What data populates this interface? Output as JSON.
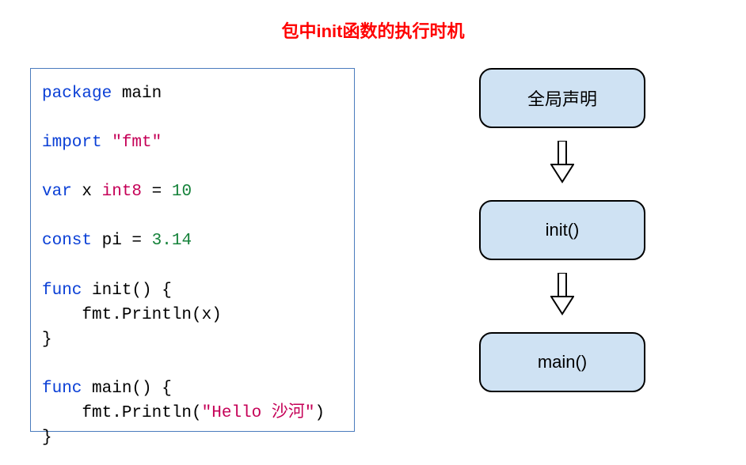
{
  "title": "包中init函数的执行时机",
  "code": {
    "l1_kw": "package",
    "l1_ident": " main",
    "l2_kw": "import",
    "l2_str": " \"fmt\"",
    "l3_kw": "var",
    "l3_rest": " x ",
    "l3_ty": "int8",
    "l3_eq": " = ",
    "l3_num": "10",
    "l4_kw": "const",
    "l4_rest": " pi = ",
    "l4_num": "3.14",
    "l5_kw": "func",
    "l5_rest": " init() {",
    "l6": "    fmt.Println(x)",
    "l7": "}",
    "l8_kw": "func",
    "l8_rest": " main() {",
    "l9a": "    fmt.Println(",
    "l9_str": "\"Hello 沙河\"",
    "l9b": ")",
    "l10": "}"
  },
  "flow": {
    "n1": "全局声明",
    "n2": "init()",
    "n3": "main()"
  }
}
